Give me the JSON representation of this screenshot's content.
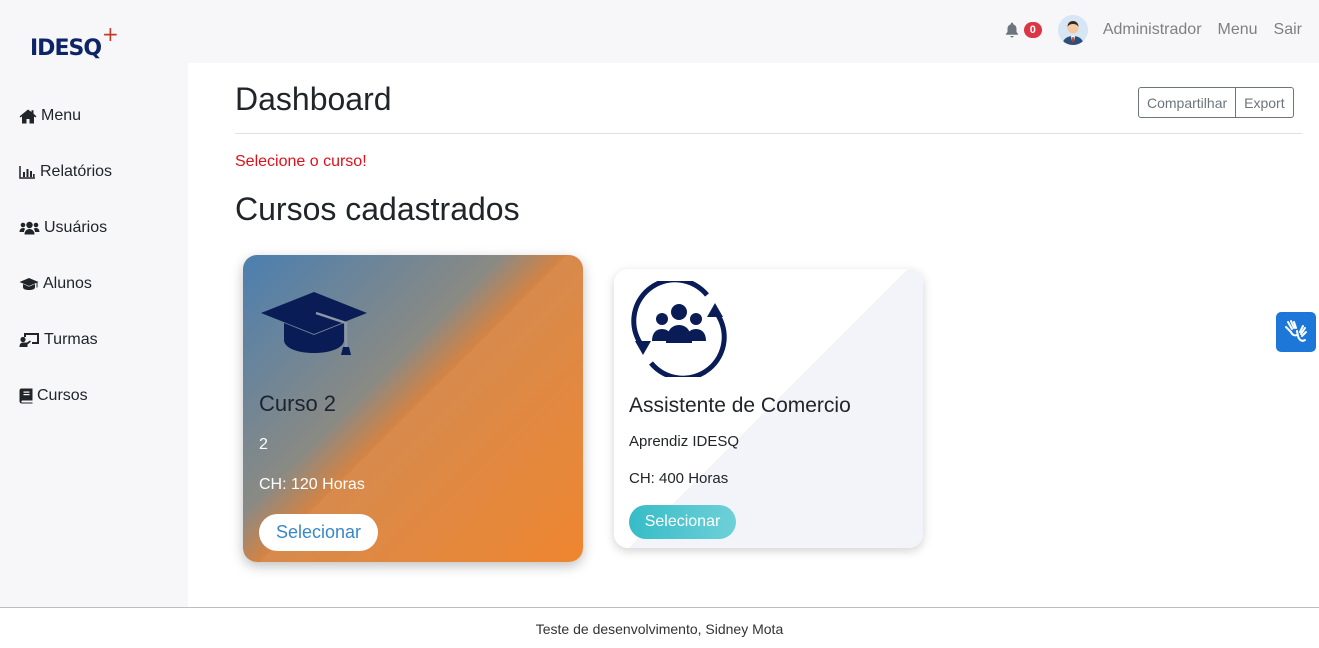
{
  "brand": {
    "logo_text": "IDESQ",
    "logo_plus": "+"
  },
  "topbar": {
    "notification_count": "0",
    "user_name": "Administrador",
    "menu_label": "Menu",
    "logout_label": "Sair"
  },
  "sidebar": {
    "items": [
      {
        "label": "Menu",
        "icon": "home-icon"
      },
      {
        "label": "Relatórios",
        "icon": "bar-chart-icon"
      },
      {
        "label": "Usuários",
        "icon": "users-icon"
      },
      {
        "label": "Alunos",
        "icon": "graduation-cap-icon"
      },
      {
        "label": "Turmas",
        "icon": "chalkboard-teacher-icon"
      },
      {
        "label": "Cursos",
        "icon": "book-icon"
      }
    ]
  },
  "main": {
    "title": "Dashboard",
    "share_label": "Compartilhar",
    "export_label": "Export",
    "alert": "Selecione o curso!",
    "section_title": "Cursos cadastrados",
    "courses": [
      {
        "name": "Curso 2",
        "description": "2",
        "hours": "CH: 120 Horas",
        "button": "Selecionar",
        "icon": "graduation-cap-icon"
      },
      {
        "name": "Assistente de Comercio",
        "description": "Aprendiz IDESQ",
        "hours": "CH: 400 Horas",
        "button": "Selecionar",
        "icon": "group-cycle-icon"
      }
    ]
  },
  "footer": {
    "text": "Teste de desenvolvimento, Sidney Mota"
  },
  "colors": {
    "brand": "#0d2466",
    "alert": "#e0101a",
    "badge": "#dc3545",
    "a11y_button": "#1d77d8"
  }
}
